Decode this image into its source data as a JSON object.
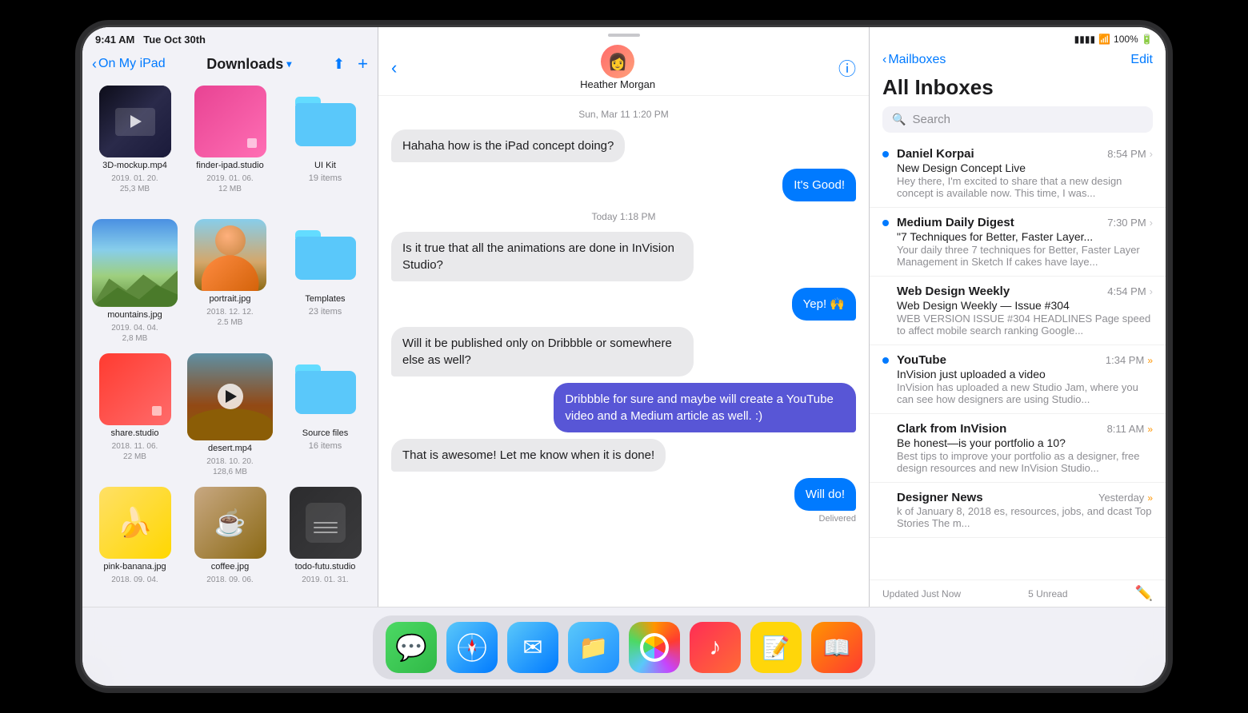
{
  "device": {
    "status_bar_left": {
      "time": "9:41 AM",
      "date": "Tue Oct 30th"
    },
    "status_bar_right": {
      "signal": "●●●●",
      "wifi": "WiFi",
      "battery": "100%"
    }
  },
  "files_panel": {
    "nav": {
      "back_label": "On My iPad",
      "title": "Downloads",
      "share_icon": "↑",
      "add_icon": "+"
    },
    "files": [
      {
        "id": "3d-mockup",
        "name": "3D-mockup.mp4",
        "meta": "2019. 01. 20.\n25,3 MB",
        "type": "video",
        "items": null
      },
      {
        "id": "finder-ipad",
        "name": "finder-ipad.studio",
        "meta": "2019. 01. 06.\n12 MB",
        "type": "studio-pink",
        "items": null
      },
      {
        "id": "ui-kit",
        "name": "UI Kit",
        "meta": null,
        "type": "folder",
        "items": "19 items"
      },
      {
        "id": "mountains",
        "name": "mountains.jpg",
        "meta": "2019. 04. 04.\n2,8 MB",
        "type": "mountain",
        "items": null
      },
      {
        "id": "portrait",
        "name": "portrait.jpg",
        "meta": "2018. 12. 12.\n2.5 MB",
        "type": "portrait",
        "items": null
      },
      {
        "id": "templates",
        "name": "Templates",
        "meta": null,
        "type": "folder",
        "items": "23 items"
      },
      {
        "id": "share-studio",
        "name": "share.studio",
        "meta": "2018. 11. 06.\n22 MB",
        "type": "studio-red",
        "items": null
      },
      {
        "id": "desert",
        "name": "desert.mp4",
        "meta": "2018. 10. 20.\n128,6 MB",
        "type": "video-desert",
        "items": null
      },
      {
        "id": "source-files",
        "name": "Source files",
        "meta": null,
        "type": "folder",
        "items": "16 items"
      },
      {
        "id": "pink-banana",
        "name": "pink-banana.jpg",
        "meta": "2018. 09. 04.",
        "type": "banana",
        "items": null
      },
      {
        "id": "coffee",
        "name": "coffee.jpg",
        "meta": "2018. 09. 06.",
        "type": "coffee",
        "items": null
      },
      {
        "id": "todo-studio",
        "name": "todo-futu.studio",
        "meta": "2019. 01. 31.",
        "type": "studio-dark",
        "items": null
      }
    ]
  },
  "messages_panel": {
    "contact": {
      "name": "Heather Morgan",
      "avatar_emoji": "👩"
    },
    "messages": [
      {
        "id": "msg1",
        "type": "timestamp",
        "text": "Sun, Mar 11 1:20 PM"
      },
      {
        "id": "msg2",
        "type": "incoming",
        "text": "Hahaha how is the iPad concept doing?"
      },
      {
        "id": "msg3",
        "type": "outgoing",
        "text": "It's Good!"
      },
      {
        "id": "msg4",
        "type": "timestamp",
        "text": "Today 1:18 PM"
      },
      {
        "id": "msg5",
        "type": "incoming",
        "text": "Is it true that all the animations are done in InVision Studio?"
      },
      {
        "id": "msg6",
        "type": "outgoing",
        "text": "Yep! 🙌"
      },
      {
        "id": "msg7",
        "type": "incoming",
        "text": "Will it be published only on Dribbble or somewhere else as well?"
      },
      {
        "id": "msg8",
        "type": "outgoing-purple",
        "text": "Dribbble for sure and maybe will create a YouTube video and a Medium article as well. :)"
      },
      {
        "id": "msg9",
        "type": "incoming",
        "text": "That is awesome! Let me know when it is done!"
      },
      {
        "id": "msg10",
        "type": "outgoing",
        "text": "Will do!"
      },
      {
        "id": "msg11",
        "type": "delivered",
        "text": "Delivered"
      }
    ]
  },
  "mail_panel": {
    "nav": {
      "back_label": "Mailboxes",
      "edit_label": "Edit",
      "title": "All Inboxes"
    },
    "search": {
      "placeholder": "Search"
    },
    "emails": [
      {
        "id": "email1",
        "sender": "Daniel Korpai",
        "subject": "New Design Concept Live",
        "preview": "Hey there, I'm excited to share that a new design concept is available now. This time, I was...",
        "time": "8:54 PM",
        "unread": true,
        "double_chevron": false
      },
      {
        "id": "email2",
        "sender": "Medium Daily Digest",
        "subject": "\"7 Techniques for Better, Faster Layer...",
        "preview": "Your daily three 7 techniques for Better, Faster Layer Management in Sketch If cakes have laye...",
        "time": "7:30 PM",
        "unread": true,
        "double_chevron": false
      },
      {
        "id": "email3",
        "sender": "Web Design Weekly",
        "subject": "Web Design Weekly — Issue #304",
        "preview": "WEB VERSION ISSUE #304 HEADLINES Page speed to affect mobile search ranking Google...",
        "time": "4:54 PM",
        "unread": false,
        "double_chevron": false
      },
      {
        "id": "email4",
        "sender": "YouTube",
        "subject": "InVision just uploaded a video",
        "preview": "InVision has uploaded a new Studio Jam, where you can see how designers are using Studio...",
        "time": "1:34 PM",
        "unread": true,
        "double_chevron": true
      },
      {
        "id": "email5",
        "sender": "Clark from InVision",
        "subject": "Be honest—is your portfolio a 10?",
        "preview": "Best tips to improve your portfolio as a designer, free design resources and new InVision Studio...",
        "time": "8:11 AM",
        "unread": false,
        "double_chevron": true
      },
      {
        "id": "email6",
        "sender": "Designer News",
        "subject": "",
        "preview": "k of January 8, 2018\nes, resources, jobs, and\ndcast Top Stories The m...",
        "time": "Yesterday",
        "unread": false,
        "double_chevron": true
      }
    ],
    "footer": {
      "unread_count": "5 Unread",
      "text": "Updated Just Now"
    }
  },
  "dock": {
    "items": [
      {
        "id": "messages",
        "label": "",
        "emoji": "💬",
        "class": "messages"
      },
      {
        "id": "safari",
        "label": "",
        "emoji": "🧭",
        "class": "safari"
      },
      {
        "id": "mail",
        "label": "",
        "emoji": "✉️",
        "class": "mail"
      },
      {
        "id": "files",
        "label": "",
        "emoji": "📁",
        "class": "files"
      },
      {
        "id": "photos",
        "label": "",
        "emoji": "🖼️",
        "class": "photos"
      },
      {
        "id": "music",
        "label": "",
        "emoji": "🎵",
        "class": "music"
      },
      {
        "id": "notes",
        "label": "",
        "emoji": "📝",
        "class": "notes"
      },
      {
        "id": "books",
        "label": "",
        "emoji": "📚",
        "class": "books"
      }
    ]
  }
}
